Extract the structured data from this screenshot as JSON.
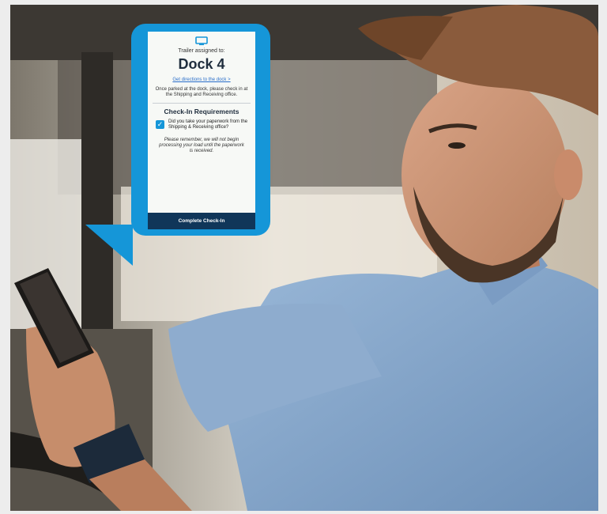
{
  "checkin_card": {
    "assign_label": "Trailer assigned to:",
    "dock_name": "Dock 4",
    "directions_link": "Get directions to the dock >",
    "instruction": "Once parked at the dock, please check in at the Shipping and Receiving office.",
    "requirements_title": "Check-In Requirements",
    "requirement_item": "Did you take your paperwork from the Shipping & Receiving office?",
    "requirement_checked": true,
    "reminder": "Please remember, we will not begin processing your load until the paperwork is received.",
    "complete_button": "Complete Check-In"
  },
  "icons": {
    "header_icon": "truck-icon",
    "check_icon": "checkmark-icon"
  },
  "colors": {
    "bubble_blue": "#1596d8",
    "button_navy": "#103659",
    "page_background": "#ededed"
  }
}
